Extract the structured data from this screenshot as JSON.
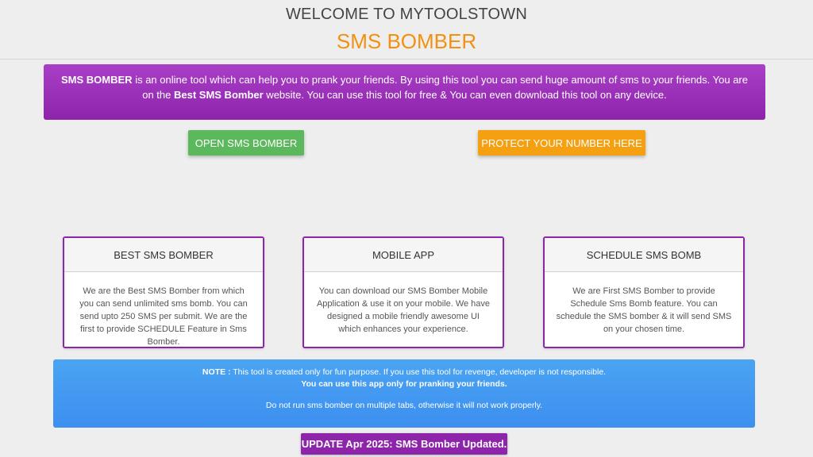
{
  "header": {
    "welcome": "WELCOME TO MYTOOLSTOWN",
    "title": "SMS BOMBER"
  },
  "intro": {
    "bold1": "SMS BOMBER",
    "text1": " is an online tool which can help you to prank your friends. By using this tool you can send huge amount of sms to your friends. You are on the ",
    "bold2": "Best SMS Bomber",
    "text2": " website. You can use this tool for free & You can even download this tool on any device."
  },
  "buttons": {
    "open": "OPEN SMS BOMBER",
    "protect": "PROTECT YOUR NUMBER HERE"
  },
  "cards": [
    {
      "title": "BEST SMS BOMBER",
      "body": "We are the Best SMS Bomber from which you can send unlimited sms bomb. You can send upto 250 SMS per submit. We are the first to provide SCHEDULE Feature in Sms Bomber."
    },
    {
      "title": "MOBILE APP",
      "body": "You can download our SMS Bomber Mobile Application & use it on your mobile. We have designed a mobile friendly awesome UI which enhances your experience."
    },
    {
      "title": "SCHEDULE SMS BOMB",
      "body": "We are First SMS Bomber to provide Schedule Sms Bomb feature. You can schedule the SMS bomber & it will send SMS on your chosen time."
    }
  ],
  "note": {
    "label": "NOTE :",
    "text": " This tool is created only for fun purpose. If you use this tool for revenge, developer is not responsible.",
    "bold_line": "You can use this app only for pranking your friends.",
    "tabs_warning": "Do not run sms bomber on multiple tabs, otherwise it will not work properly."
  },
  "update": {
    "label": "UPDATE Apr 2025: SMS Bomber Updated."
  },
  "colors": {
    "purple": "#8e24aa",
    "orange": "#f5a011",
    "green": "#5cb85c",
    "blue": "#4aa4f2",
    "title_orange": "#f29111"
  }
}
